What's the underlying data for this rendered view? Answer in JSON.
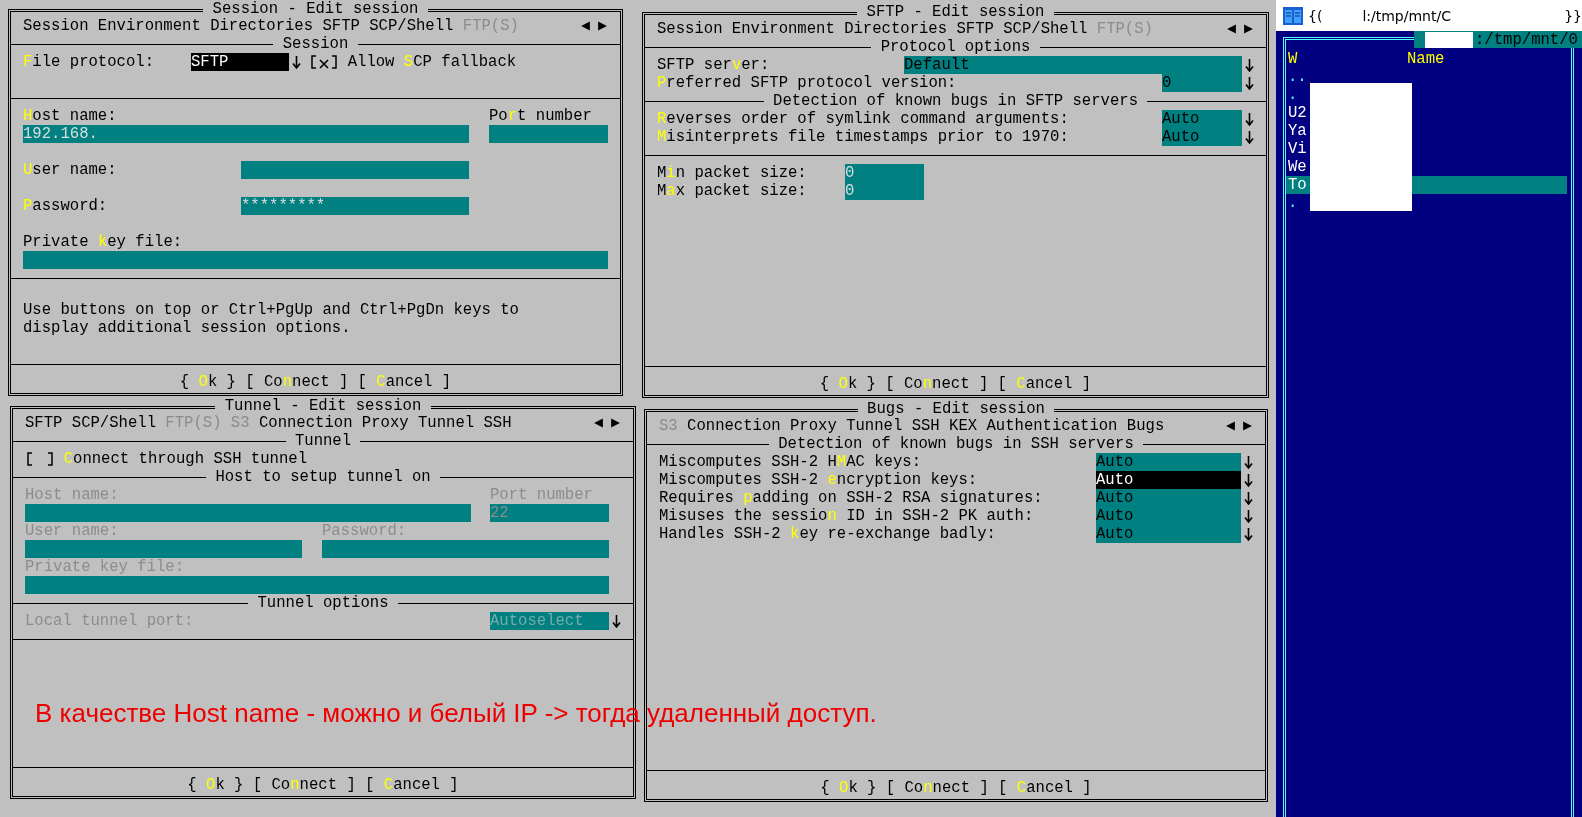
{
  "dialogs": [
    {
      "kind": "session",
      "title": "Session - Edit session",
      "tabs": [
        {
          "label": "Session",
          "disabled": false
        },
        {
          "label": "Environment",
          "disabled": false
        },
        {
          "label": "Directories",
          "disabled": false
        },
        {
          "label": "SFTP",
          "disabled": false
        },
        {
          "label": "SCP/Shell",
          "disabled": false
        },
        {
          "label": "FTP(S)",
          "disabled": true
        }
      ],
      "section_title": "Session",
      "protocol": {
        "label": "**F**ile protocol:",
        "value": "SFTP",
        "focused": true
      },
      "scp_fallback": {
        "label": "Allow **S**CP fallback",
        "checked": true
      },
      "host": {
        "label": "**H**ost name:",
        "value": "192.168."
      },
      "port": {
        "label": "Po**r**t number"
      },
      "user": {
        "label": "**U**ser name:"
      },
      "password": {
        "label": "**P**assword:",
        "value": "*********"
      },
      "key_file": {
        "label": "Private **k**ey file:"
      },
      "note": "Use buttons on top or Ctrl+PgUp and Ctrl+PgDn keys to display additional session options.",
      "buttons": [
        "{ **O**k }",
        "[ Co**n**nect ]",
        "[ **C**ancel ]"
      ]
    },
    {
      "kind": "sftp",
      "title": "SFTP - Edit session",
      "tabs": [
        {
          "label": "Session",
          "disabled": false
        },
        {
          "label": "Environment",
          "disabled": false
        },
        {
          "label": "Directories",
          "disabled": false
        },
        {
          "label": "SFTP",
          "disabled": false
        },
        {
          "label": "SCP/Shell",
          "disabled": false
        },
        {
          "label": "FTP(S)",
          "disabled": true
        }
      ],
      "sections": [
        {
          "title": "Protocol options",
          "rows": [
            {
              "label": "SFTP ser**v**er:",
              "value": "Default"
            },
            {
              "label": "**P**referred SFTP protocol version:",
              "value": "0"
            }
          ]
        },
        {
          "title": "Detection of known bugs in SFTP servers",
          "rows": [
            {
              "label": "**R**everses order of symlink command arguments:",
              "value": "Auto"
            },
            {
              "label": "**M**isinterprets file timestamps prior to 1970:",
              "value": "Auto"
            }
          ]
        }
      ],
      "packet_sizes": [
        {
          "label": "M**i**n packet size:",
          "value": "0"
        },
        {
          "label": "M**a**x packet size:",
          "value": "0"
        }
      ],
      "buttons": [
        "{ **O**k }",
        "[ Co**n**nect ]",
        "[ **C**ancel ]"
      ]
    },
    {
      "kind": "tunnel",
      "title": "Tunnel - Edit session",
      "tabs": [
        {
          "label": "SFTP",
          "disabled": false
        },
        {
          "label": "SCP/Shell",
          "disabled": false
        },
        {
          "label": "FTP(S)",
          "disabled": true
        },
        {
          "label": "S3",
          "disabled": true
        },
        {
          "label": "Connection",
          "disabled": false
        },
        {
          "label": "Proxy",
          "disabled": false
        },
        {
          "label": "Tunnel",
          "disabled": false
        },
        {
          "label": "SSH",
          "disabled": false
        }
      ],
      "tunnel_title": "Tunnel",
      "use_tunnel": {
        "label": "**C**onnect through SSH tunnel",
        "checked": false
      },
      "host_title": "Host to setup tunnel on",
      "host": {
        "label": "Host name:",
        "disabled": true
      },
      "port": {
        "label": "Port number",
        "value": "22",
        "disabled": true
      },
      "user": {
        "label": "User name:",
        "disabled": true
      },
      "password": {
        "label": "Password:",
        "disabled": true
      },
      "key_file": {
        "label": "Private key file:",
        "disabled": true
      },
      "options_title": "Tunnel options",
      "local_port": {
        "label": "Local tunnel port:",
        "value": "Autoselect",
        "disabled": true
      },
      "buttons": [
        "{ **O**k }",
        "[ Co**n**nect ]",
        "[ **C**ancel ]"
      ]
    },
    {
      "kind": "bugs",
      "title": "Bugs - Edit session",
      "tabs": [
        {
          "label": "S3",
          "disabled": true
        },
        {
          "label": "Connection",
          "disabled": false
        },
        {
          "label": "Proxy",
          "disabled": false
        },
        {
          "label": "Tunnel",
          "disabled": false
        },
        {
          "label": "SSH",
          "disabled": false
        },
        {
          "label": "KEX",
          "disabled": false
        },
        {
          "label": "Authentication",
          "disabled": false
        },
        {
          "label": "Bugs",
          "disabled": false
        }
      ],
      "section_title": "Detection of known bugs in SSH servers",
      "rows": [
        {
          "label": "Miscomputes SSH-2 H**M**AC keys:",
          "value": "Auto",
          "focused": false
        },
        {
          "label": "Miscomputes SSH-2 **e**ncryption keys:",
          "value": "Auto",
          "focused": true
        },
        {
          "label": "Requires **p**adding on SSH-2 RSA signatures:",
          "value": "Auto",
          "focused": false
        },
        {
          "label": "Misuses the sessio**n** ID in SSH-2 PK auth:",
          "value": "Auto",
          "focused": false
        },
        {
          "label": "Handles SSH-2 **k**ey re-exchange badly:",
          "value": "Auto",
          "focused": false
        }
      ],
      "buttons": [
        "{ **O**k }",
        "[ Co**n**nect ]",
        "[ **C**ancel ]"
      ]
    }
  ],
  "annotation": "В качестве Host name - можно и белый IP -> тогда удаленный доступ.",
  "panel": {
    "title_prefix": "{(",
    "title_path": "l:/tmp/mnt/C",
    "title_suffix": "}}",
    "path": ":/tmp/mnt/0",
    "columns": [
      "W",
      "Name"
    ],
    "items": [
      {
        "name": "..",
        "hidden": true,
        "selected": false
      },
      {
        "name": ".",
        "hidden": true,
        "selected": false
      },
      {
        "name": "U2",
        "hidden": false,
        "selected": false
      },
      {
        "name": "Ya",
        "hidden": false,
        "selected": false
      },
      {
        "name": "Vi",
        "hidden": false,
        "selected": false
      },
      {
        "name": "We",
        "hidden": false,
        "selected": false
      },
      {
        "name": "To",
        "hidden": false,
        "selected": true
      },
      {
        "name": ".",
        "hidden": true,
        "selected": false
      }
    ]
  }
}
